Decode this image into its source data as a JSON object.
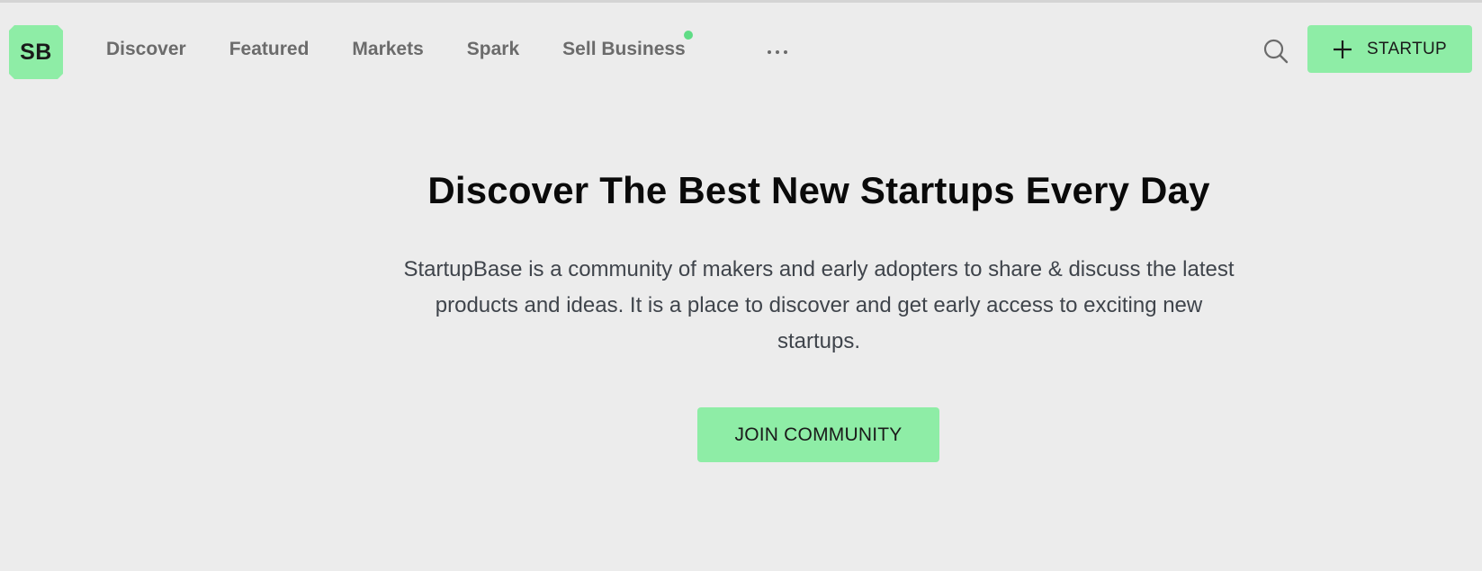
{
  "header": {
    "logo_text": "SB",
    "nav": [
      {
        "label": "Discover"
      },
      {
        "label": "Featured"
      },
      {
        "label": "Markets"
      },
      {
        "label": "Spark"
      },
      {
        "label": "Sell Business",
        "has_dot": true
      }
    ],
    "more_icon": "ellipsis-icon",
    "search_icon": "search-icon",
    "add_startup": {
      "icon": "plus-icon",
      "label": "STARTUP"
    }
  },
  "hero": {
    "title": "Discover The Best New Startups Every Day",
    "description": "StartupBase is a community of makers and early adopters to share & discuss the latest products and ideas. It is a place to discover and get early access to exciting new startups.",
    "cta_label": "JOIN COMMUNITY"
  },
  "colors": {
    "background": "#ececec",
    "accent": "#8eeda6",
    "nav_text": "#6b6b6b",
    "notification_dot": "#5fdc85"
  }
}
